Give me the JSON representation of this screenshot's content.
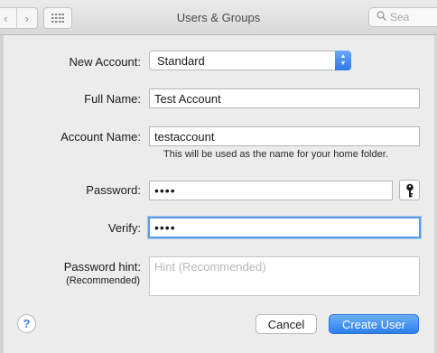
{
  "window": {
    "title": "Users & Groups"
  },
  "toolbar": {
    "back_glyph": "‹",
    "forward_glyph": "›",
    "search_placeholder": "Sea"
  },
  "form": {
    "new_account_label": "New Account:",
    "account_type": "Standard",
    "full_name_label": "Full Name:",
    "full_name_value": "Test Account",
    "account_name_label": "Account Name:",
    "account_name_value": "testaccount",
    "account_name_hint": "This will be used as the name for your home folder.",
    "password_label": "Password:",
    "password_value": "••••",
    "verify_label": "Verify:",
    "verify_value": "••••",
    "hint_label": "Password hint:",
    "hint_sublabel": "(Recommended)",
    "hint_placeholder": "Hint (Recommended)"
  },
  "buttons": {
    "help": "?",
    "cancel": "Cancel",
    "create": "Create User"
  },
  "colors": {
    "accent": "#2c7ef0",
    "focus_ring": "#5b9ae3"
  },
  "icons": [
    "back-icon",
    "forward-icon",
    "grid-icon",
    "search-icon",
    "key-icon",
    "help-icon",
    "popup-arrows-icon"
  ]
}
